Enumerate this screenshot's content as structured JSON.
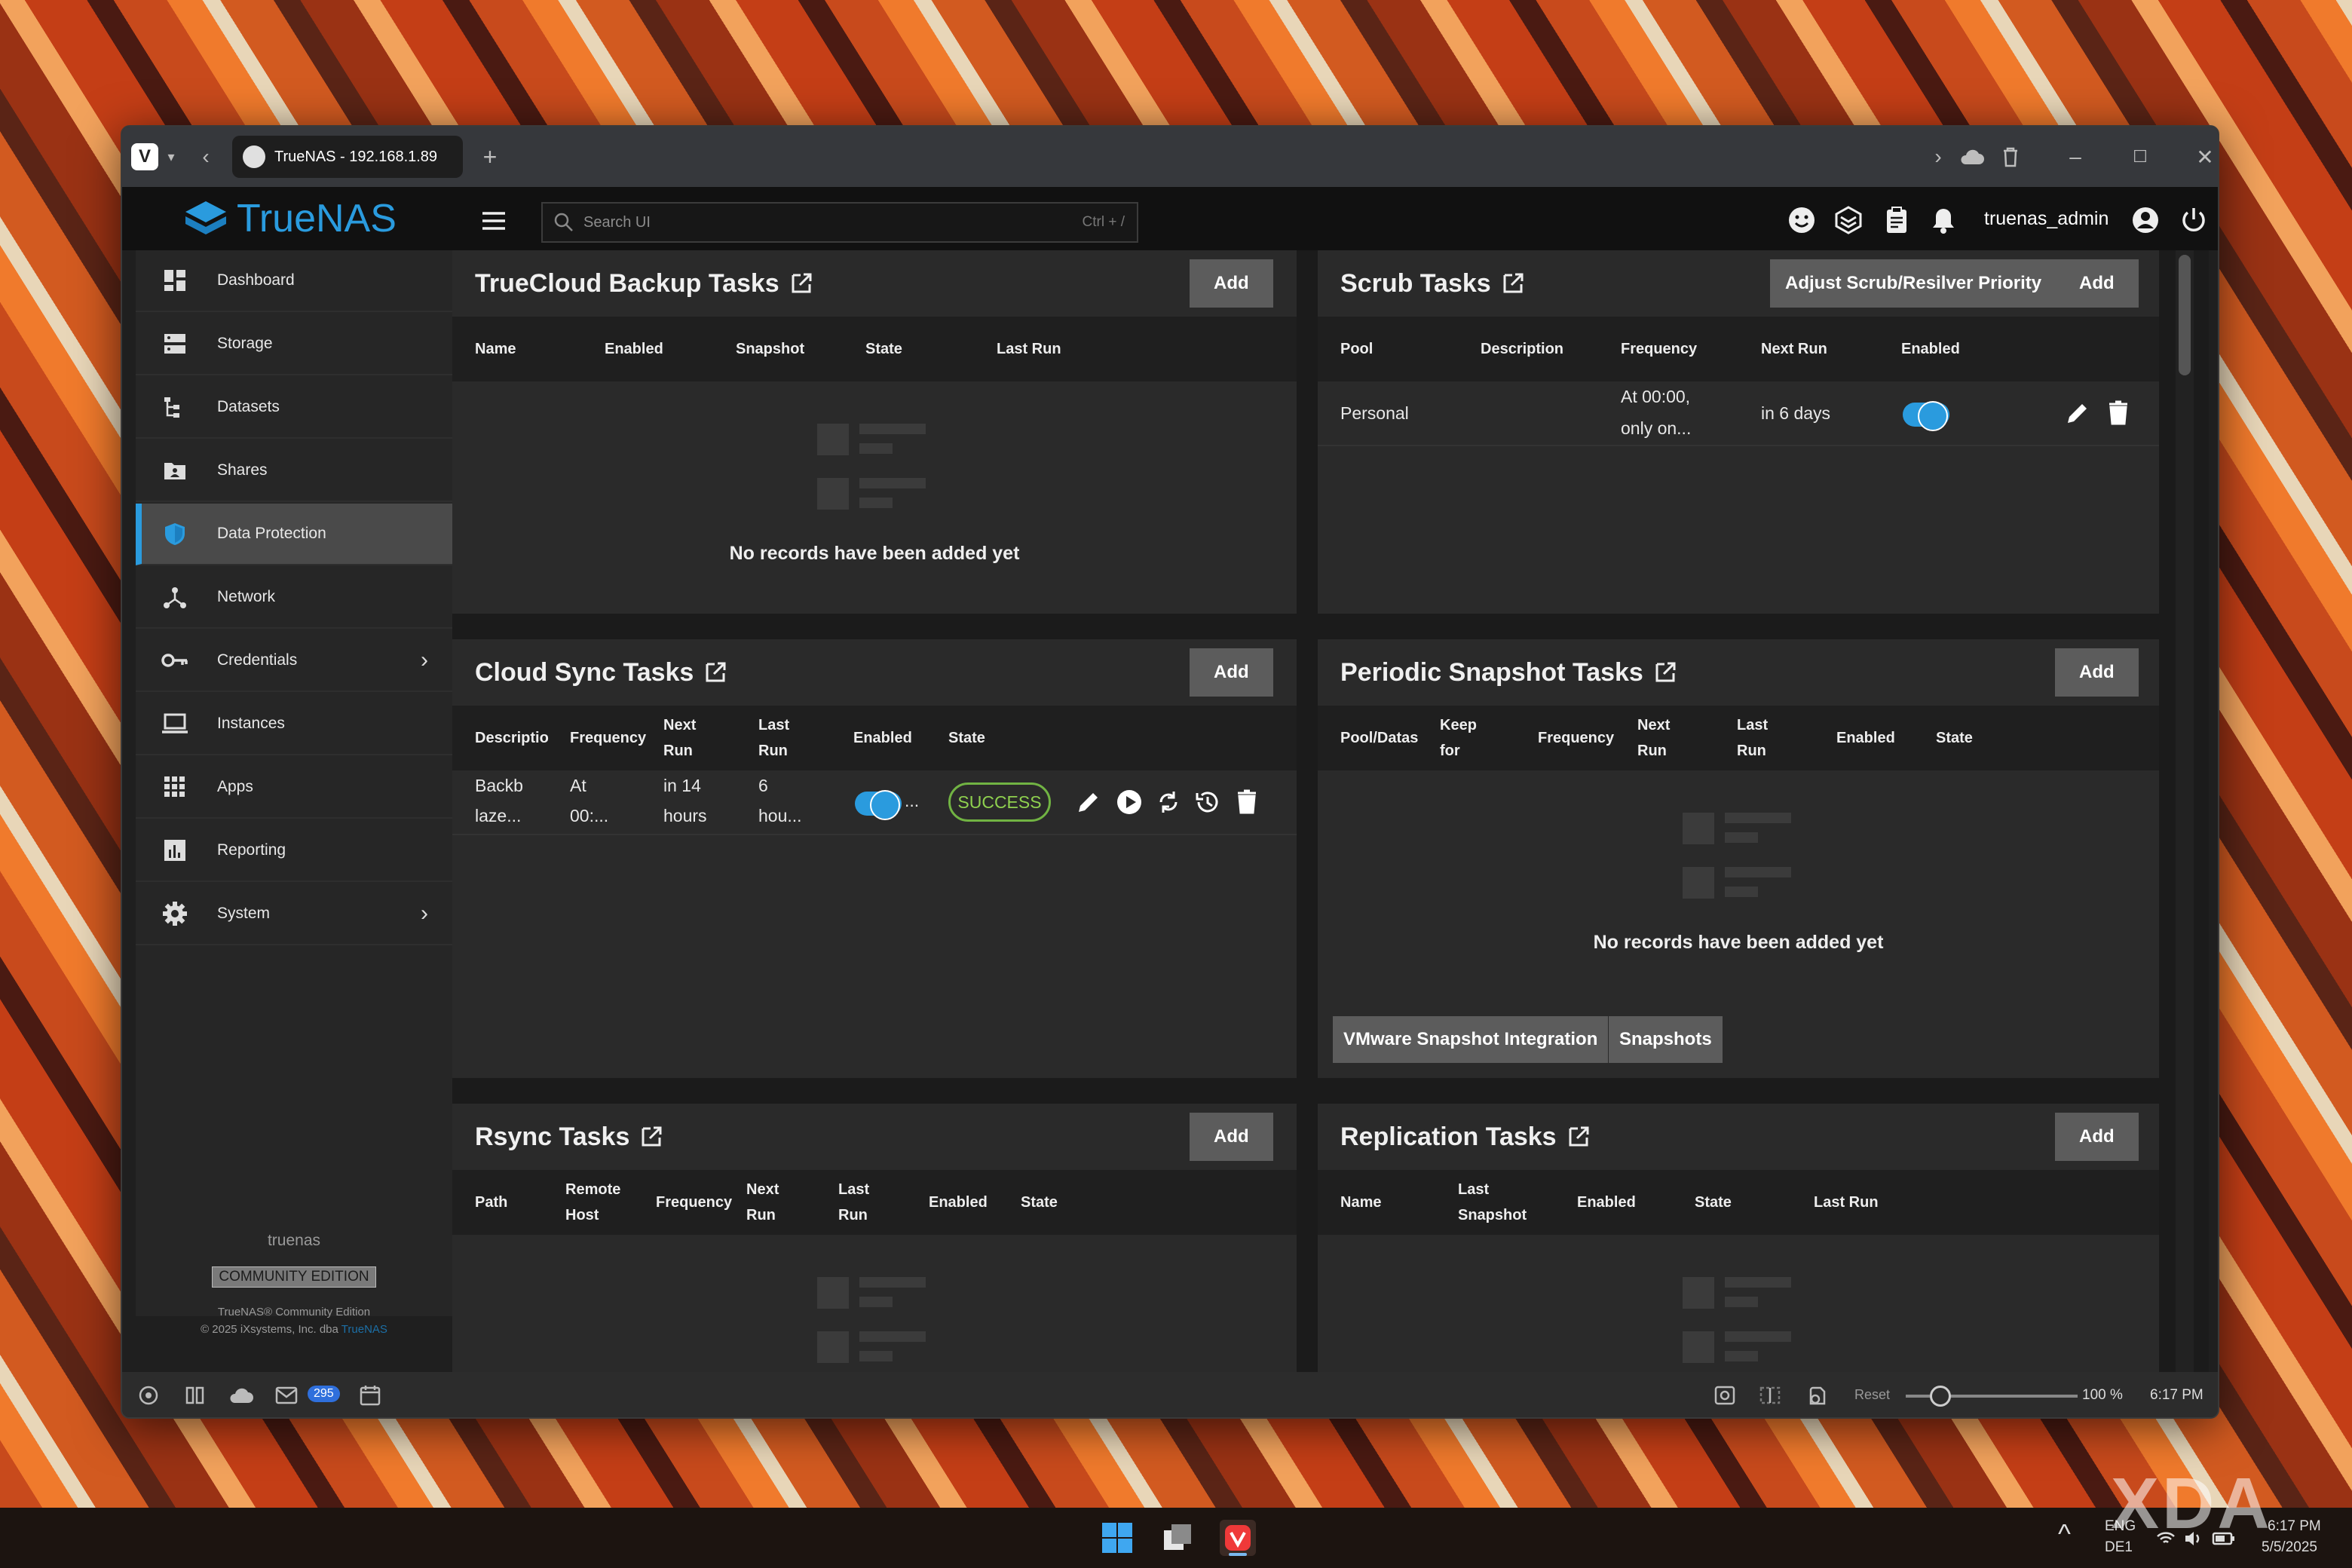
{
  "browser": {
    "tab_title": "TrueNAS - 192.168.1.89",
    "new_tab": "+"
  },
  "app": {
    "logo_text": "TrueNAS",
    "search_placeholder": "Search UI",
    "search_shortcut": "Ctrl + /",
    "username": "truenas_admin"
  },
  "sidebar": {
    "items": [
      {
        "label": "Dashboard",
        "icon": "dashboard-icon"
      },
      {
        "label": "Storage",
        "icon": "storage-icon"
      },
      {
        "label": "Datasets",
        "icon": "datasets-icon"
      },
      {
        "label": "Shares",
        "icon": "shares-icon"
      },
      {
        "label": "Data Protection",
        "icon": "shield-icon"
      },
      {
        "label": "Network",
        "icon": "network-icon"
      },
      {
        "label": "Credentials",
        "icon": "key-icon"
      },
      {
        "label": "Instances",
        "icon": "laptop-icon"
      },
      {
        "label": "Apps",
        "icon": "apps-grid-icon"
      },
      {
        "label": "Reporting",
        "icon": "chart-icon"
      },
      {
        "label": "System",
        "icon": "gear-icon"
      }
    ],
    "hostname": "truenas",
    "edition": "COMMUNITY EDITION",
    "copyright_line1": "TrueNAS® Community Edition",
    "copyright_line2": "© 2025 iXsystems, Inc. dba",
    "copyright_link": "TrueNAS"
  },
  "cards": {
    "truecloud": {
      "title": "TrueCloud Backup Tasks",
      "add": "Add",
      "columns": [
        "Name",
        "Enabled",
        "Snapshot",
        "State",
        "Last Run"
      ],
      "empty": "No records have been added yet"
    },
    "scrub": {
      "title": "Scrub Tasks",
      "adjust": "Adjust Scrub/Resilver Priority",
      "add": "Add",
      "columns": [
        "Pool",
        "Description",
        "Frequency",
        "Next Run",
        "Enabled"
      ],
      "row": {
        "pool": "Personal",
        "freq1": "At 00:00,",
        "freq2": "only on...",
        "next_run": "in 6 days"
      }
    },
    "cloudsync": {
      "title": "Cloud Sync Tasks",
      "add": "Add",
      "columns": [
        "Descriptio",
        "Frequency",
        "Next",
        "Run",
        "Last",
        "Run",
        "Enabled",
        "State"
      ],
      "row": {
        "desc1": "Backb",
        "desc2": "laze...",
        "freq1": "At",
        "freq2": "00:...",
        "next1": "in 14",
        "next2": "hours",
        "last1": "6",
        "last2": "hou...",
        "enabled_more": "...",
        "state": "SUCCESS"
      }
    },
    "periodic": {
      "title": "Periodic Snapshot Tasks",
      "add": "Add",
      "columns": [
        "Pool/Datas",
        "Keep",
        "for",
        "Frequency",
        "Next",
        "Run",
        "Last",
        "Run",
        "Enabled",
        "State"
      ],
      "empty": "No records have been added yet",
      "vmware": "VMware Snapshot Integration",
      "snapshots": "Snapshots"
    },
    "rsync": {
      "title": "Rsync Tasks",
      "add": "Add",
      "columns": [
        "Path",
        "Remote",
        "Host",
        "Frequency",
        "Next",
        "Run",
        "Last",
        "Run",
        "Enabled",
        "State"
      ]
    },
    "replication": {
      "title": "Replication Tasks",
      "add": "Add",
      "columns": [
        "Name",
        "Last",
        "Snapshot",
        "Enabled",
        "State",
        "Last Run"
      ]
    }
  },
  "statusbar": {
    "mail_count": "295",
    "reset": "Reset",
    "zoom": "100 %",
    "time": "6:17 PM",
    "zoom_fraction": 0.2
  },
  "taskbar": {
    "lang1": "ENG",
    "lang2": "DE1",
    "time": "6:17 PM",
    "date": "5/5/2025",
    "watermark": "XDA"
  },
  "colors": {
    "accent": "#2a9bde",
    "success": "#71b343",
    "card_bg": "#2a2a2a"
  }
}
